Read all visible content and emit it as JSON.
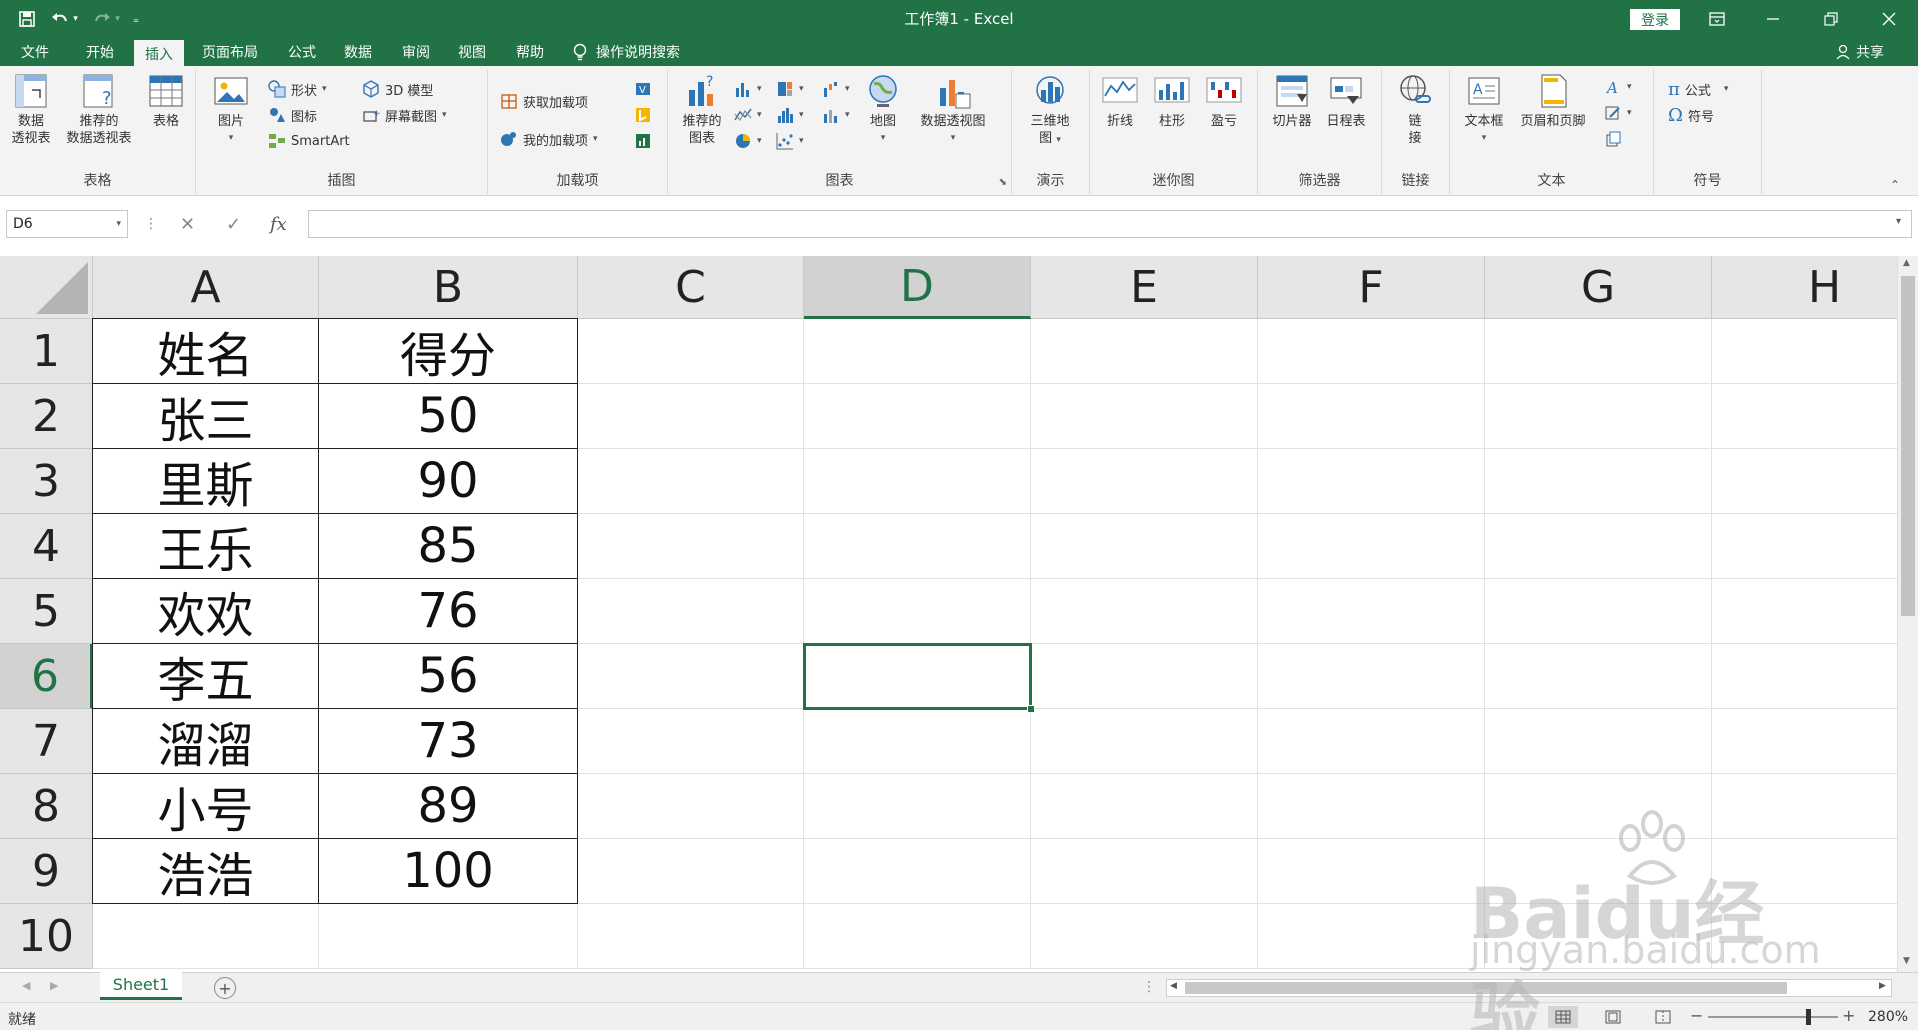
{
  "app": {
    "title": "工作簿1  -  Excel",
    "login": "登录",
    "accent": "#217346"
  },
  "tabs": [
    "文件",
    "开始",
    "插入",
    "页面布局",
    "公式",
    "数据",
    "审阅",
    "视图",
    "帮助"
  ],
  "active_tab": "插入",
  "tell_me": "操作说明搜索",
  "share": "共享",
  "ribbon": {
    "tables": {
      "label": "表格",
      "pivot1": "数据",
      "pivot2": "透视表",
      "rec1": "推荐的",
      "rec2": "数据透视表",
      "table": "表格"
    },
    "illustrations": {
      "label": "插图",
      "picture": "图片",
      "shapes": "形状",
      "icons": "图标",
      "smartart": "SmartArt",
      "model3d": "3D 模型",
      "screenshot": "屏幕截图"
    },
    "addins": {
      "label": "加载项",
      "get": "获取加载项",
      "mine": "我的加载项"
    },
    "charts": {
      "label": "图表",
      "recommended1": "推荐的",
      "recommended2": "图表",
      "map": "地图",
      "pivotchart": "数据透视图"
    },
    "tours": {
      "label": "演示",
      "map3d1": "三维地",
      "map3d2": "图"
    },
    "sparklines": {
      "label": "迷你图",
      "line": "折线",
      "column": "柱形",
      "winloss": "盈亏"
    },
    "filters": {
      "label": "筛选器",
      "slicer": "切片器",
      "timeline": "日程表"
    },
    "links": {
      "label": "链接",
      "link1": "链",
      "link2": "接"
    },
    "text": {
      "label": "文本",
      "textbox": "文本框",
      "headerfooter": "页眉和页脚"
    },
    "symbols": {
      "label": "符号",
      "equation": "公式",
      "symbol": "符号"
    }
  },
  "formula_bar": {
    "name_box": "D6",
    "fx": "fx",
    "value": ""
  },
  "grid": {
    "columns": [
      "A",
      "B",
      "C",
      "D",
      "E",
      "F",
      "G",
      "H"
    ],
    "rows": [
      "1",
      "2",
      "3",
      "4",
      "5",
      "6",
      "7",
      "8",
      "9",
      "10"
    ],
    "selected_column": "D",
    "selected_row": "6",
    "data": [
      [
        "姓名",
        "得分"
      ],
      [
        "张三",
        "50"
      ],
      [
        "里斯",
        "90"
      ],
      [
        "王乐",
        "85"
      ],
      [
        "欢欢",
        "76"
      ],
      [
        "李五",
        "56"
      ],
      [
        "溜溜",
        "73"
      ],
      [
        "小号",
        "89"
      ],
      [
        "浩浩",
        "100"
      ]
    ]
  },
  "sheets": [
    "Sheet1"
  ],
  "status": {
    "ready": "就绪",
    "zoom": "280%"
  },
  "watermark": {
    "main": "Baidu经验",
    "sub": "jingyan.baidu.com"
  }
}
